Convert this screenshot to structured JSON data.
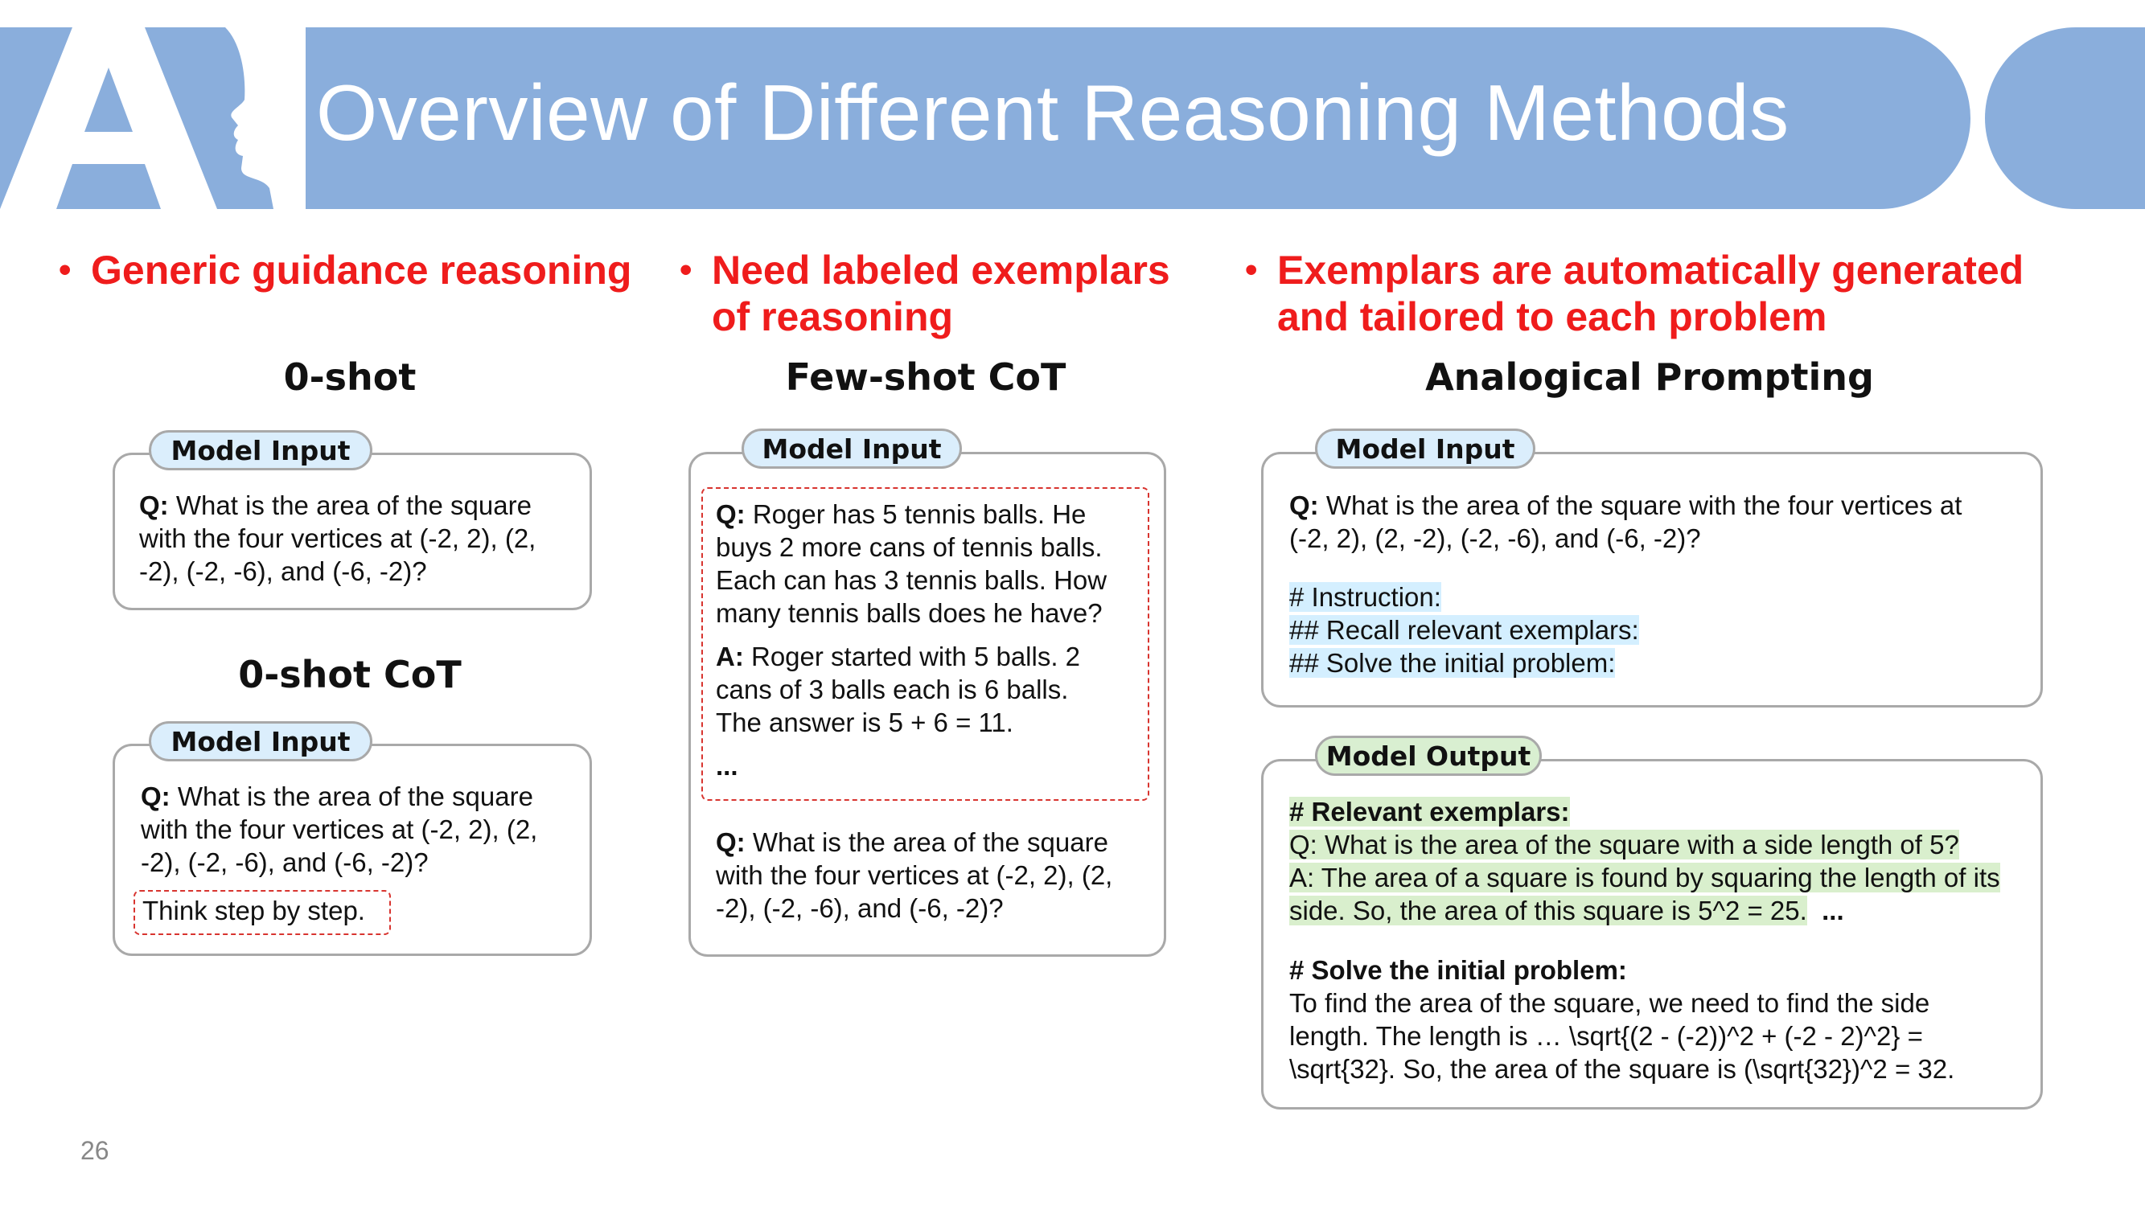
{
  "slide": {
    "title": "Overview of Different Reasoning Methods",
    "page_number": "26",
    "logo_text": "AI"
  },
  "columns": [
    {
      "bullet": "Generic guidance reasoning",
      "title": "0-shot",
      "input_tag": "Model Input",
      "question_label": "Q:",
      "question": "What is the area of the square with the four vertices at (-2, 2), (2, -2), (-2, -6), and (-6, -2)?",
      "question_lines": [
        "What is the area of the square",
        "with the four vertices at (-2, 2), (2,",
        "-2), (-2, -6), and (-6, -2)?"
      ],
      "subtitle": "0-shot CoT",
      "input_tag_2": "Model Input",
      "question_lines_2": [
        "What is the area of the square",
        "with the four vertices at (-2, 2), (2,",
        "-2), (-2, -6), and (-6, -2)?"
      ],
      "instruction": "Think step by step."
    },
    {
      "bullet_lines": [
        "Need labeled exemplars",
        "of reasoning"
      ],
      "title": "Few-shot CoT",
      "input_tag": "Model Input",
      "exemplar_q_lines": [
        "Roger has 5 tennis balls. He",
        "buys 2 more cans of tennis balls.",
        "Each can has 3 tennis balls. How",
        "many tennis balls does he have?"
      ],
      "answer_label": "A:",
      "exemplar_a_lines": [
        "Roger started with 5 balls. 2",
        "cans of 3 balls each is 6 balls.",
        "The answer is 5 + 6 = 11."
      ],
      "ellipsis": "...",
      "question_lines": [
        "What is the area of the square",
        "with the four vertices at (-2, 2), (2,",
        "-2), (-2, -6), and (-6, -2)?"
      ]
    },
    {
      "bullet_lines": [
        "Exemplars are automatically generated",
        "and tailored to each problem"
      ],
      "title": "Analogical Prompting",
      "input_tag": "Model Input",
      "question_lines": [
        "What is the area of the square with the four vertices at",
        "(-2, 2), (2, -2), (-2, -6), and (-6, -2)?"
      ],
      "instructions": [
        "# Instruction:",
        "## Recall relevant exemplars:",
        "## Solve the initial problem:"
      ],
      "output_tag": "Model Output",
      "exemplars_heading": "# Relevant exemplars:",
      "exemplar_lines": [
        "Q: What is the area of the square with a side length of 5?",
        "A: The area of a square is found by squaring the length of its",
        "side. So, the area of this square is 5^2 = 25."
      ],
      "exemplar_ellipsis": "...",
      "solve_heading": "# Solve the initial problem:",
      "solve_lines": [
        "To find the area of the square, we need to find the side",
        "length. The length is … \\sqrt{(2 - (-2))^2 + (-2 - 2)^2} =",
        "\\sqrt{32}. So, the area of the square is (\\sqrt{32})^2 = 32."
      ]
    }
  ],
  "colors": {
    "banner": "#8aaedc",
    "bullet_red": "#ef1c1c",
    "input_tag_bg": "#dbeefc",
    "output_tag_bg": "#d9efd1",
    "highlight_blue": "#d4efff",
    "highlight_green": "#d9efcd"
  }
}
